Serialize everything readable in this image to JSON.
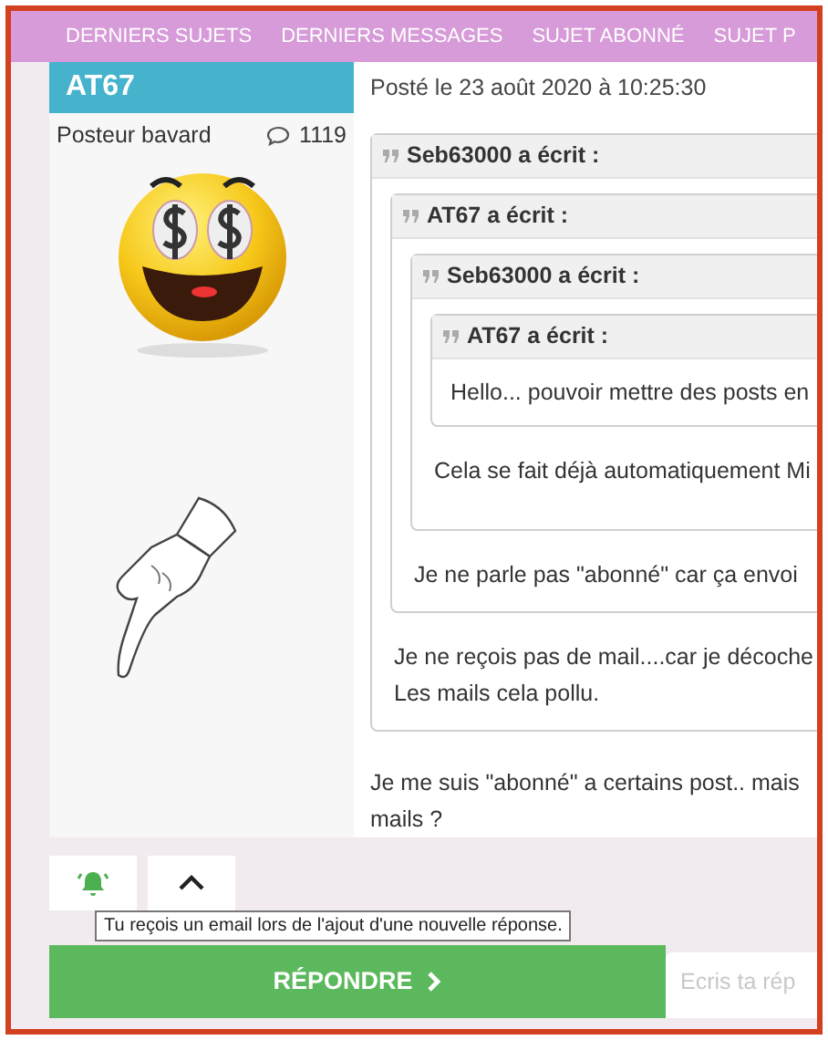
{
  "nav": {
    "items": [
      {
        "label": "DERNIERS SUJETS"
      },
      {
        "label": "DERNIERS MESSAGES"
      },
      {
        "label": "SUJET ABONNÉ"
      },
      {
        "label": "SUJET P"
      }
    ]
  },
  "post": {
    "author": "AT67",
    "rank": "Posteur bavard",
    "post_count": "1119",
    "date": "Posté le 23 août 2020 à 10:25:30",
    "quote": {
      "header": "Seb63000 a écrit :",
      "lines": [
        "Je ne reçois pas de mail....car je décoche",
        "Les mails cela pollu."
      ],
      "quote": {
        "header": "AT67 a écrit :",
        "lines": [
          "Je ne parle pas \"abonné\" car ça envoi"
        ],
        "quote": {
          "header": "Seb63000 a écrit :",
          "lines": [
            "Cela se fait déjà automatiquement Mi"
          ],
          "quote": {
            "header": "AT67 a écrit :",
            "lines": [
              "Hello... pouvoir mettre des posts en"
            ]
          }
        }
      }
    },
    "body": [
      "Je me suis \"abonné\" a certains post.. mais",
      "mails ?"
    ]
  },
  "actions": {
    "subscribed": true,
    "tooltip": "Tu reçois un email lors de l'ajout d'une nouvelle réponse."
  },
  "reply": {
    "button": "RÉPONDRE",
    "placeholder": "Ecris ta rép"
  }
}
